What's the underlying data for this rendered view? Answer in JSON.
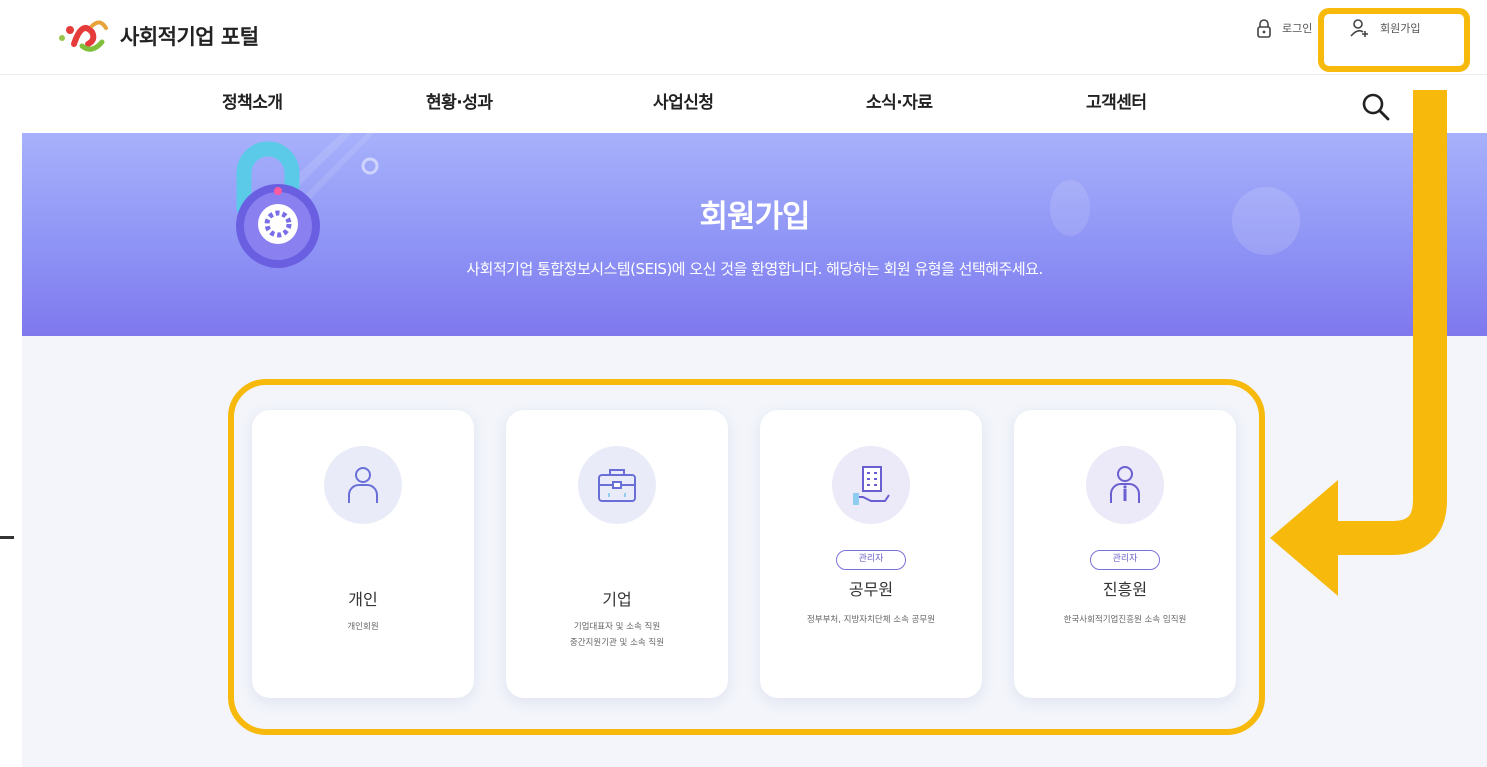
{
  "header": {
    "logo_text": "사회적기업 포털",
    "login_label": "로그인",
    "signup_label": "회원가입"
  },
  "gnb": {
    "items": [
      {
        "label": "정책소개"
      },
      {
        "label": "현황·성과"
      },
      {
        "label": "사업신청"
      },
      {
        "label": "소식·자료"
      },
      {
        "label": "고객센터"
      }
    ]
  },
  "banner": {
    "title": "회원가입",
    "subtitle": "사회적기업 통합정보시스템(SEIS)에 오신 것을 환영합니다. 해당하는 회원 유형을 선택해주세요."
  },
  "cards": [
    {
      "title": "개인",
      "desc1": "개인회원",
      "desc2": "",
      "badge": "",
      "icon": "person-icon"
    },
    {
      "title": "기업",
      "desc1": "기업대표자 및 소속 직원",
      "desc2": "중간지원기관 및 소속 직원",
      "badge": "",
      "icon": "briefcase-icon"
    },
    {
      "title": "공무원",
      "desc1": "정부부처, 지방자치단체 소속 공무원",
      "desc2": "",
      "badge": "관리자",
      "icon": "building-hand-icon"
    },
    {
      "title": "진흥원",
      "desc1": "한국사회적기업진흥원 소속 임직원",
      "desc2": "",
      "badge": "관리자",
      "icon": "staff-icon"
    }
  ],
  "side_text": "",
  "colors": {
    "highlight": "#f6b90c",
    "banner_top": "#a7b1fb",
    "banner_bottom": "#7f78ee",
    "badge": "#7b72d9"
  }
}
